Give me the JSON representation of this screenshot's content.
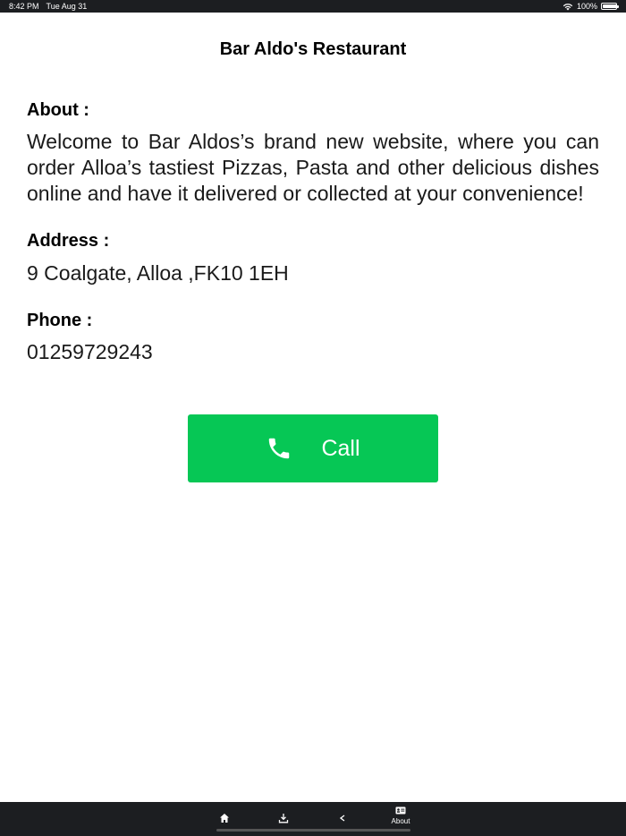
{
  "status_bar": {
    "time": "8:42 PM",
    "date": "Tue Aug 31",
    "battery": "100%",
    "battery_level": 1.0
  },
  "header": {
    "title": "Bar Aldo's Restaurant"
  },
  "about": {
    "label": "About :",
    "text": "Welcome to Bar Aldos’s brand new website, where you can order Alloa’s tastiest Pizzas, Pasta and other delicious dishes online and have it delivered or collected at your convenience!"
  },
  "address": {
    "label": "Address :",
    "text": "9 Coalgate, Alloa ,FK10 1EH"
  },
  "phone": {
    "label": "Phone :",
    "text": "01259729243"
  },
  "call_button": {
    "label": "Call",
    "icon": "phone-icon",
    "color": "#06c755"
  },
  "tab_bar": {
    "items": [
      {
        "icon": "home-icon"
      },
      {
        "icon": "download-icon"
      },
      {
        "icon": "share-icon"
      },
      {
        "icon": "about-icon",
        "label": "About"
      }
    ],
    "background": "#1c1e21"
  }
}
